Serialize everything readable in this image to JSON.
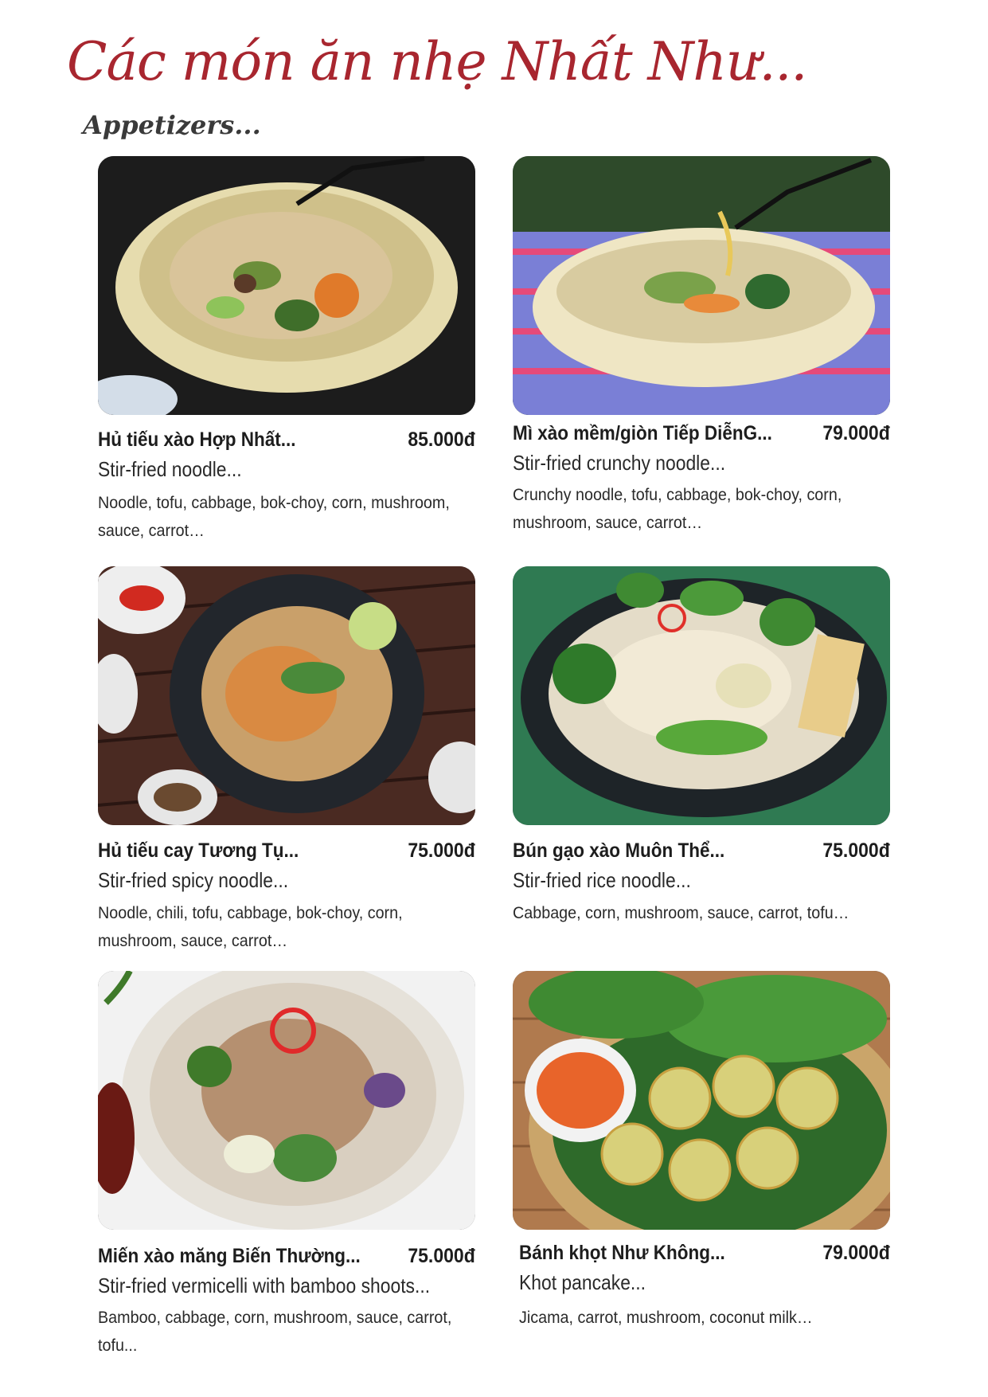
{
  "header": {
    "title": "Các món ăn nhẹ Nhất Như...",
    "subtitle": "Appetizers..."
  },
  "colors": {
    "title": "#a8262f",
    "text": "#1d1d1d"
  },
  "items": [
    {
      "name": "Hủ tiếu xào Hợp Nhất...",
      "price": "85.000đ",
      "english": "Stir-fried noodle...",
      "ingredients": "Noodle, tofu, cabbage, bok-choy, corn, mushroom, sauce, carrot…"
    },
    {
      "name": "Mì xào mềm/giòn Tiếp DiễnG...",
      "price": "79.000đ",
      "english": "Stir-fried crunchy noodle...",
      "ingredients": "Crunchy noodle, tofu, cabbage, bok-choy, corn, mushroom, sauce, carrot…"
    },
    {
      "name": "Hủ tiếu cay Tương Tụ...",
      "price": "75.000đ",
      "english": "Stir-fried spicy noodle...",
      "ingredients": "Noodle, chili, tofu, cabbage, bok-choy, corn, mushroom, sauce, carrot…"
    },
    {
      "name": "Bún gạo xào Muôn Thể...",
      "price": "75.000đ",
      "english": "Stir-fried rice noodle...",
      "ingredients": "Cabbage, corn, mushroom, sauce, carrot, tofu…"
    },
    {
      "name": "Miến xào măng Biến Thường...",
      "price": "75.000đ",
      "english": "Stir-fried vermicelli with bamboo shoots...",
      "ingredients": "Bamboo, cabbage, corn, mushroom, sauce, carrot, tofu..."
    },
    {
      "name": "Bánh khọt Như Không...",
      "price": "79.000đ",
      "english": "Khot pancake...",
      "ingredients": "Jicama, carrot, mushroom, coconut milk…"
    }
  ]
}
